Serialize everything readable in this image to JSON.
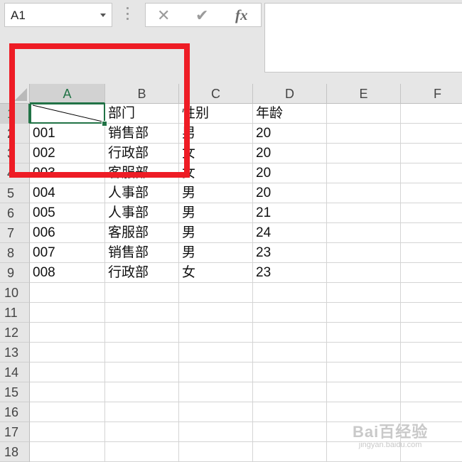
{
  "name_box": {
    "value": "A1"
  },
  "formula_buttons": {
    "cancel": "✕",
    "enter": "✔",
    "fx": "fx"
  },
  "columns": [
    "A",
    "B",
    "C",
    "D",
    "E",
    "F"
  ],
  "rows": [
    "1",
    "2",
    "3",
    "4",
    "5",
    "6",
    "7",
    "8",
    "9",
    "10",
    "11",
    "12",
    "13",
    "14",
    "15",
    "16",
    "17",
    "18"
  ],
  "sheet": {
    "header": {
      "b": "部门",
      "c": "性别",
      "d": "年龄"
    },
    "records": [
      {
        "a": "001",
        "b": "销售部",
        "c": "男",
        "d": "20"
      },
      {
        "a": "002",
        "b": "行政部",
        "c": "女",
        "d": "20"
      },
      {
        "a": "003",
        "b": "客服部",
        "c": "女",
        "d": "20"
      },
      {
        "a": "004",
        "b": "人事部",
        "c": "男",
        "d": "20"
      },
      {
        "a": "005",
        "b": "人事部",
        "c": "男",
        "d": "21"
      },
      {
        "a": "006",
        "b": "客服部",
        "c": "男",
        "d": "24"
      },
      {
        "a": "007",
        "b": "销售部",
        "c": "男",
        "d": "23"
      },
      {
        "a": "008",
        "b": "行政部",
        "c": "女",
        "d": "23"
      }
    ]
  },
  "watermark": {
    "brand": "Bai百经验",
    "url": "jingyan.baidu.com"
  },
  "colors": {
    "selection": "#217346",
    "highlight_box": "#ee1c25"
  }
}
